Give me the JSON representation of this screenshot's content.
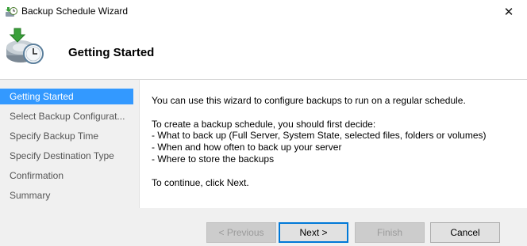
{
  "window": {
    "title": "Backup Schedule Wizard",
    "close_glyph": "✕",
    "icon": "backup-wizard-icon"
  },
  "header": {
    "heading": "Getting Started",
    "icon": "backup-clock-icon"
  },
  "nav": {
    "items": [
      {
        "label": "Getting Started",
        "active": true
      },
      {
        "label": "Select Backup Configurat...",
        "active": false
      },
      {
        "label": "Specify Backup Time",
        "active": false
      },
      {
        "label": "Specify Destination Type",
        "active": false
      },
      {
        "label": "Confirmation",
        "active": false
      },
      {
        "label": "Summary",
        "active": false
      }
    ]
  },
  "content": {
    "intro": "You can use this wizard to configure backups to run on a regular schedule.",
    "create_lead": "To create a backup schedule, you should first decide:",
    "bullets": [
      "-  What to back up (Full Server, System State, selected files, folders or volumes)",
      "-  When and how often to back up your server",
      "-  Where to store the backups"
    ],
    "continue_text": "To continue, click Next."
  },
  "buttons": {
    "previous": "< Previous",
    "next": "Next >",
    "finish": "Finish",
    "cancel": "Cancel"
  },
  "colors": {
    "selection": "#3399ff",
    "default_button_border": "#0078d7"
  }
}
